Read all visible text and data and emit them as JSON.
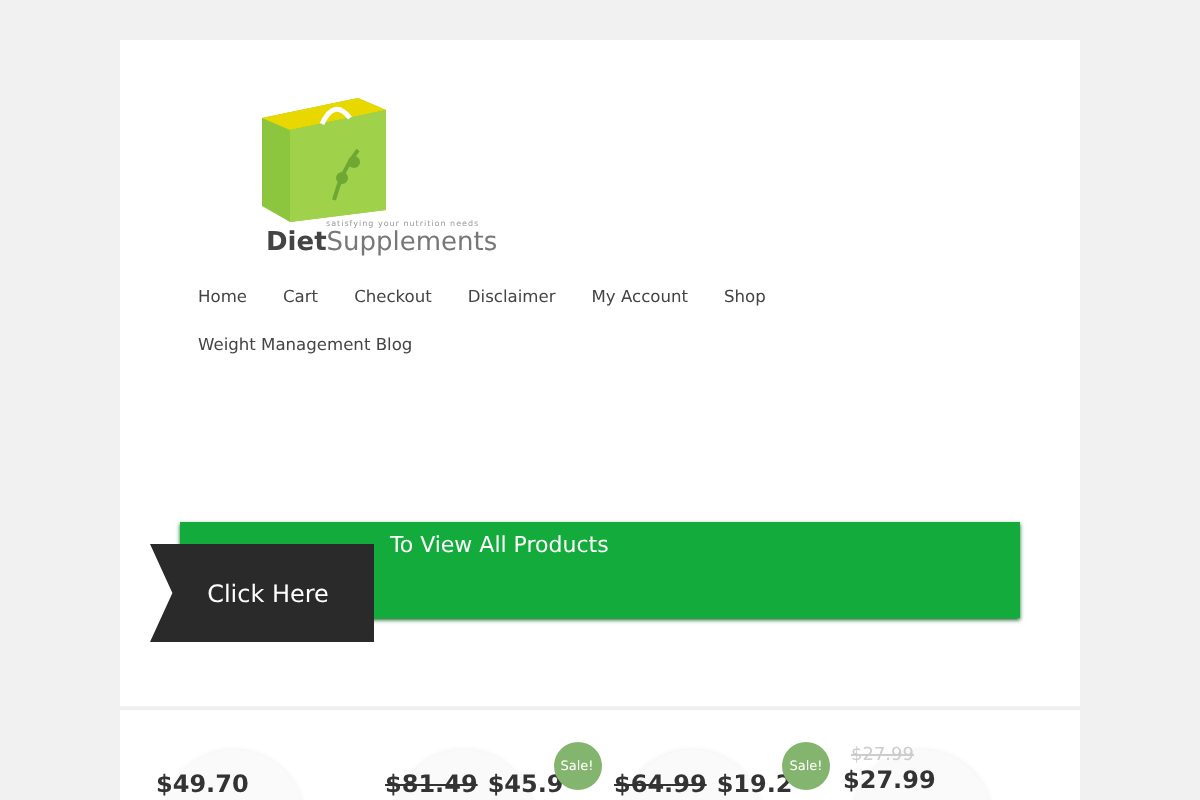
{
  "logo": {
    "brand_first": "Diet",
    "brand_second": "Supplements",
    "tagline": "satisfying your nutrition needs"
  },
  "nav": [
    {
      "label": "Home"
    },
    {
      "label": "Cart"
    },
    {
      "label": "Checkout"
    },
    {
      "label": "Disclaimer"
    },
    {
      "label": "My Account"
    },
    {
      "label": "Shop"
    },
    {
      "label": "Weight Management Blog"
    }
  ],
  "banner": {
    "text": "To View All Products",
    "button": "Click Here"
  },
  "products": [
    {
      "kind": "inline",
      "price": "$49.70"
    },
    {
      "kind": "inline",
      "old_price": "$81.49",
      "price": "$45.9",
      "sale_badge": "Sale!"
    },
    {
      "kind": "inline",
      "old_price": "$64.99",
      "price": "$19.2",
      "sale_badge": "Sale!"
    },
    {
      "kind": "stacked",
      "old_price": "$27.99",
      "price": "$27.99"
    }
  ]
}
